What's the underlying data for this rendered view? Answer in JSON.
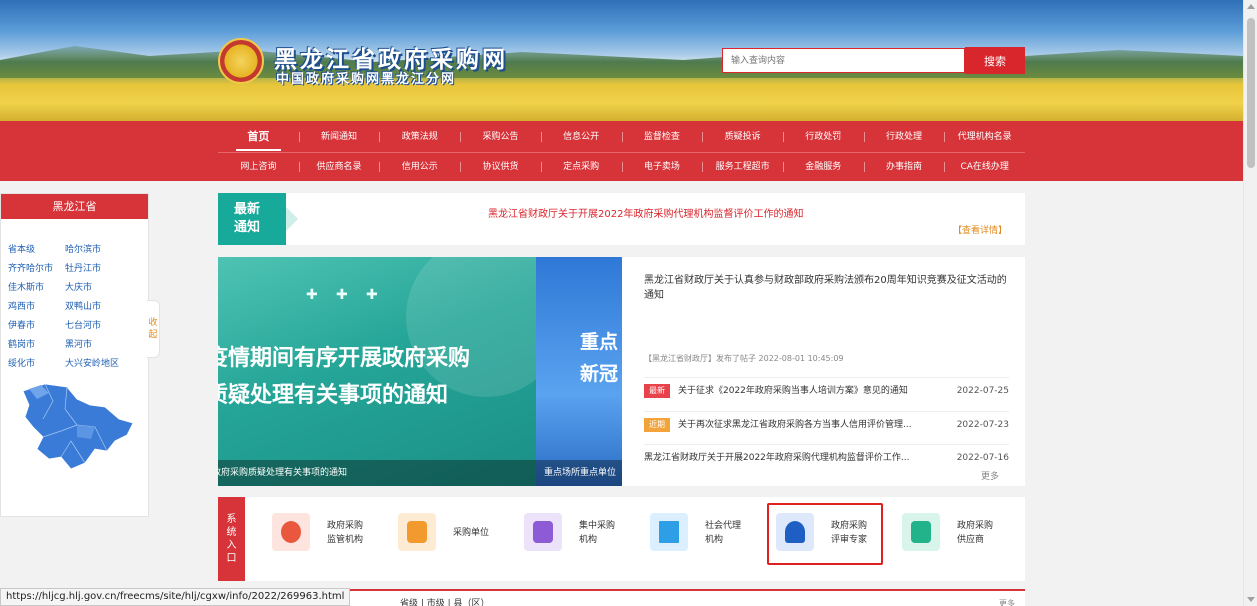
{
  "header": {
    "title": "黑龙江省政府采购网",
    "subtitle": "中国政府采购网黑龙江分网",
    "search_placeholder": "输入查询内容",
    "search_button": "搜索"
  },
  "nav": {
    "row1": [
      "首页",
      "新闻通知",
      "政策法规",
      "采购公告",
      "信息公开",
      "监督检查",
      "质疑投诉",
      "行政处罚",
      "行政处理",
      "代理机构名录"
    ],
    "row2": [
      "网上咨询",
      "供应商名录",
      "信用公示",
      "协议供货",
      "定点采购",
      "电子卖场",
      "服务工程超市",
      "金融服务",
      "办事指南",
      "CA在线办理"
    ]
  },
  "sidebar": {
    "title": "黑龙江省",
    "regions": [
      "省本级",
      "哈尔滨市",
      "齐齐哈尔市",
      "牡丹江市",
      "佳木斯市",
      "大庆市",
      "鸡西市",
      "双鸭山市",
      "伊春市",
      "七台河市",
      "鹤岗市",
      "黑河市",
      "绥化市",
      "大兴安岭地区"
    ],
    "collapse_label": "收起"
  },
  "notice": {
    "badge_line1": "最新",
    "badge_line2": "通知",
    "text": "黑龙江省财政厅关于开展2022年政府采购代理机构监督评价工作的通知",
    "more": "【查看详情】"
  },
  "carousel": {
    "line1": "疫情期间有序开展政府采购",
    "line2": "质疑处理有关事项的通知",
    "caption": "关于疫情期间有序开展政府采购质疑处理有关事项的通知",
    "next_line1": "重点",
    "next_line2": "新冠",
    "next_caption": "重点场所重点单位"
  },
  "news": {
    "headline": "黑龙江省财政厅关于认真参与财政部政府采购法颁布20周年知识竞赛及征文活动的通知",
    "meta": "【黑龙江省财政厅】发布了帖子   2022-08-01 10:45:09",
    "items": [
      {
        "tag": "最新",
        "title": "关于征求《2022年政府采购当事人培训方案》意见的通知",
        "date": "2022-07-25"
      },
      {
        "tag": "近期",
        "title": "关于再次征求黑龙江省政府采购各方当事人信用评价管理...",
        "date": "2022-07-23"
      },
      {
        "tag": "",
        "title": "黑龙江省财政厅关于开展2022年政府采购代理机构监督评价工作...",
        "date": "2022-07-16"
      }
    ],
    "more": "更多"
  },
  "system_entry": {
    "label": [
      "系",
      "统",
      "入",
      "口"
    ],
    "entries": [
      {
        "line1": "政府采购",
        "line2": "监管机构",
        "icon": "supervision-icon",
        "color": "#e9573f"
      },
      {
        "line1": "采购单位",
        "line2": "",
        "icon": "buyer-icon",
        "color": "#f29a2e"
      },
      {
        "line1": "集中采购",
        "line2": "机构",
        "icon": "cart-icon",
        "color": "#8e5bd6"
      },
      {
        "line1": "社会代理",
        "line2": "机构",
        "icon": "building-icon",
        "color": "#2e9ee6"
      },
      {
        "line1": "政府采购",
        "line2": "评审专家",
        "icon": "expert-icon",
        "color": "#1f5fc4"
      },
      {
        "line1": "政府采购",
        "line2": "供应商",
        "icon": "supplier-icon",
        "color": "#22b38a"
      }
    ]
  },
  "bottom": {
    "tabs": "省级   |   市级   |   县（区）",
    "more": "更多"
  },
  "status_url": "https://hljcg.hlj.gov.cn/freecms/site/hlj/cgxw/info/2022/269963.html",
  "colors": {
    "primary_red": "#d7343a",
    "teal": "#17a99a",
    "link_blue": "#1e5fb4",
    "highlight": "#e02020"
  }
}
